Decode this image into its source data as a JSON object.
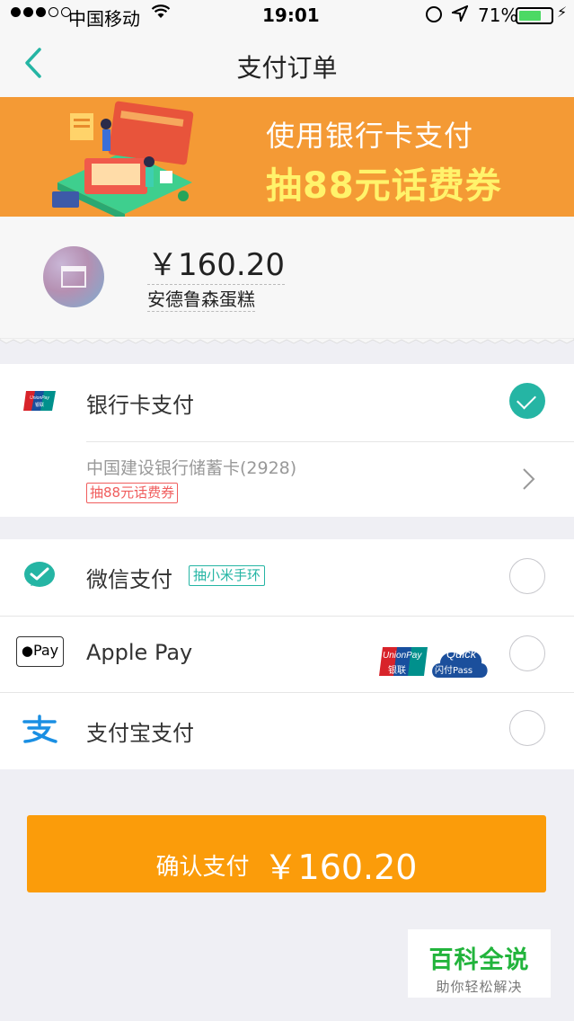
{
  "status_bar": {
    "carrier": "中国移动",
    "time": "19:01",
    "battery_percent": "71%",
    "battery_level": 0.71
  },
  "nav": {
    "title": "支付订单",
    "back_icon": "chevron-left-icon"
  },
  "banner": {
    "line1": "使用银行卡支付",
    "line2": "抽88元话费券"
  },
  "merchant": {
    "amount": "￥160.20",
    "name": "安德鲁森蛋糕"
  },
  "payment_methods": {
    "bank_card": {
      "label": "银行卡支付",
      "selected": true,
      "card_name": "中国建设银行储蓄卡(2928)",
      "promo": "抽88元话费券",
      "logo_text": "UnionPay 银联"
    },
    "wechat": {
      "label": "微信支付",
      "promo": "抽小米手环",
      "selected": false
    },
    "apple_pay": {
      "label": "Apple Pay",
      "badge": "Pay",
      "unionpay_text": "UnionPay",
      "unionpay_cn": "银联",
      "quickpass_text": "Quick",
      "quickpass_sub": "闪付Pass",
      "selected": false
    },
    "alipay": {
      "label": "支付宝支付",
      "selected": false
    }
  },
  "confirm": {
    "label": "确认支付",
    "amount": "￥160.20"
  },
  "watermark": {
    "title": "百科全说",
    "subtitle": "助你轻松解决"
  },
  "colors": {
    "accent": "#25b5a4",
    "banner": "#f49a35",
    "button": "#fb9c0a",
    "promo_red": "#f05d5d"
  }
}
